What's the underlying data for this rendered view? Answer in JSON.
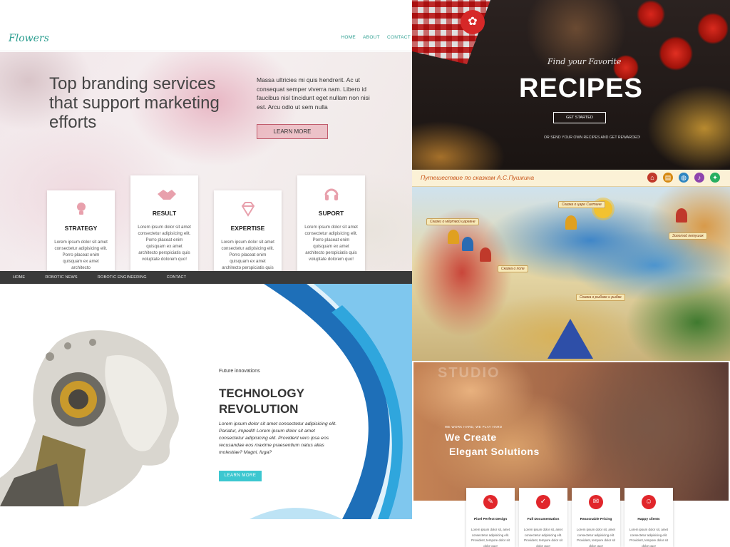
{
  "flowers": {
    "logo": "Flowers",
    "nav": [
      "HOME",
      "ABOUT",
      "CONTACT"
    ],
    "heading": "Top branding services that support marketing efforts",
    "paragraph": "Massa ultricies mi quis hendrerit. Ac ut consequat semper viverra nam. Libero id faucibus nisl tincidunt eget nullam non nisi est. Arcu odio ut sem nulla",
    "button": "LEARN MORE",
    "cards": [
      {
        "title": "STRATEGY",
        "icon": "lightbulb-icon",
        "text": "Lorem ipsum dolor sit amet consectetur adipisicing elit. Porro placeat enim quisquam ex amet architecto"
      },
      {
        "title": "RESULT",
        "icon": "handshake-icon",
        "text": "Lorem ipsum dolor sit amet consectetur adipisicing elit. Porro placeat enim quisquam ex amet architecto perspiciatis quis voluptate dolorem quo!"
      },
      {
        "title": "EXPERTISE",
        "icon": "diamond-icon",
        "text": "Lorem ipsum dolor sit amet consectetur adipisicing elit. Porro placeat enim quisquam ex amet architecto perspiciatis quis voluptate dolorem quo!"
      },
      {
        "title": "SUPORT",
        "icon": "headphones-icon",
        "text": "Lorem ipsum dolor sit amet consectetur adipisicing elit. Porro placeat enim quisquam ex amet architecto perspiciatis quis voluptate dolorem quo!"
      }
    ],
    "accent": "#2a9d8f",
    "pink": "#e8a0ac"
  },
  "recipes": {
    "kicker": "Find your Favorite",
    "title": "RECIPES",
    "button": "GET STARTED",
    "sub": "OR SEND YOUR OWN RECIPES AND GET REWARDED!"
  },
  "pushkin": {
    "title": "Путешествие по сказкам А.С.Пушкина",
    "ribbons": [
      "Сказки о мёртвой царевне",
      "Сказка о царе Салтане",
      "Сказка о попе",
      "Сказка о рыбаке и рыбке",
      "Золотой петушок"
    ],
    "icons": [
      "home-icon",
      "book-icon",
      "globe-icon",
      "music-icon",
      "settings-icon"
    ]
  },
  "robot": {
    "nav": [
      "HOME",
      "ROBOTIC NEWS",
      "ROBOTIC ENGINEERING",
      "CONTACT"
    ],
    "kicker": "Future innovations",
    "heading_line1": "TECHNOLOGY",
    "heading_line2": "REVOLUTION",
    "paragraph": "Lorem ipsum dolor sit amet consectetur adipisicing elit. Pariatur, impedit! Lorem ipsum dolor sit amet consectetur adipisicing elit. Provident vero ipsa eos recusandae eos maxime praesentium natus alias molestiae? Magni, fuga?",
    "button": "LEARN MORE",
    "accent": "#3cc7d0"
  },
  "studio": {
    "watermark": "STUDIO",
    "small": "WE WORK HARD, WE PLAY HARD",
    "line1": "We Create",
    "line2": "Elegant Solutions",
    "cards": [
      {
        "title": "Pixel Perfect Design",
        "icon": "pen-icon",
        "text": "Lorem ipsum dolor sit, amet consectetur adipisicing elit. Provident, tempore dolor sit dolor quo!"
      },
      {
        "title": "Full Documentation",
        "icon": "check-icon",
        "text": "Lorem ipsum dolor sit, amet consectetur adipisicing elit. Provident, tempore dolor sit dolor quo!"
      },
      {
        "title": "Reasonable Pricing",
        "icon": "chat-icon",
        "text": "Lorem ipsum dolor sit, amet consectetur adipisicing elit. Provident, tempore dolor sit dolor quo!"
      },
      {
        "title": "Happy clients",
        "icon": "people-icon",
        "text": "Lorem ipsum dolor sit, amet consectetur adipisicing elit. Provident, tempore dolor sit dolor quo!"
      }
    ],
    "accent": "#e1262b"
  }
}
